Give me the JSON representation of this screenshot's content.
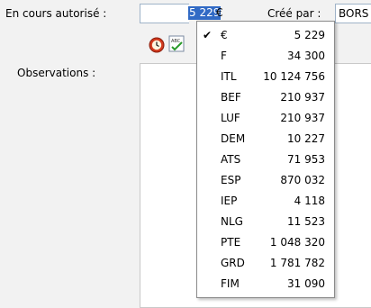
{
  "form": {
    "encours_label": "En cours autorisé :",
    "encours_value": "5 229",
    "currency_symbol": "€",
    "cree_par_label": "Créé par :",
    "cree_par_value": "BORS",
    "observations_label": "Observations :"
  },
  "toolbar": {
    "icons": [
      "clock-icon",
      "spellcheck-icon"
    ]
  },
  "currency_menu": {
    "items": [
      {
        "code": "€",
        "amount": "5 229",
        "checked": true
      },
      {
        "code": "F",
        "amount": "34 300",
        "checked": false
      },
      {
        "code": "ITL",
        "amount": "10 124 756",
        "checked": false
      },
      {
        "code": "BEF",
        "amount": "210 937",
        "checked": false
      },
      {
        "code": "LUF",
        "amount": "210 937",
        "checked": false
      },
      {
        "code": "DEM",
        "amount": "10 227",
        "checked": false
      },
      {
        "code": "ATS",
        "amount": "71 953",
        "checked": false
      },
      {
        "code": "ESP",
        "amount": "870 032",
        "checked": false
      },
      {
        "code": "IEP",
        "amount": "4 118",
        "checked": false
      },
      {
        "code": "NLG",
        "amount": "11 523",
        "checked": false
      },
      {
        "code": "PTE",
        "amount": "1 048 320",
        "checked": false
      },
      {
        "code": "GRD",
        "amount": "1 781 782",
        "checked": false
      },
      {
        "code": "FIM",
        "amount": "31 090",
        "checked": false
      }
    ]
  }
}
